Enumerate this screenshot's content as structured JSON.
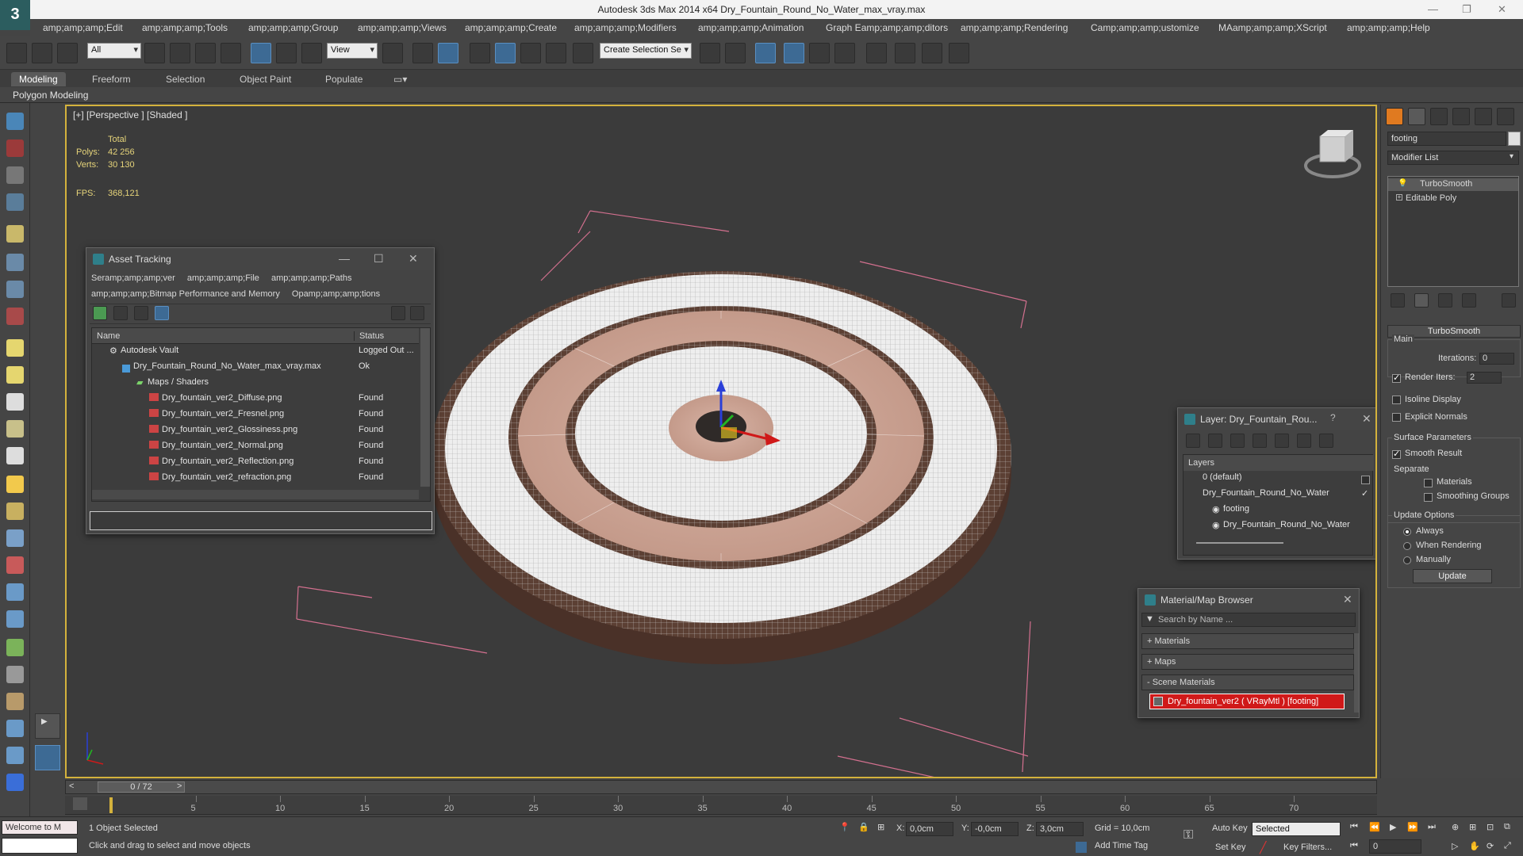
{
  "window": {
    "title": "Autodesk 3ds Max  2014 x64     Dry_Fountain_Round_No_Water_max_vray.max",
    "logo": "3"
  },
  "menu": [
    "amp;amp;amp;Edit",
    "amp;amp;amp;Tools",
    "amp;amp;amp;Group",
    "amp;amp;amp;Views",
    "amp;amp;amp;Create",
    "amp;amp;amp;Modifiers",
    "amp;amp;amp;Animation",
    "Graph Eamp;amp;amp;ditors",
    "amp;amp;amp;Rendering",
    "Camp;amp;amp;ustomize",
    "MAamp;amp;amp;XScript",
    "amp;amp;amp;Help"
  ],
  "toolbar": {
    "filter_value": "All",
    "refcoord_value": "View",
    "selection_set_placeholder": "Create Selection Se"
  },
  "ribbon": {
    "tabs": [
      "Modeling",
      "Freeform",
      "Selection",
      "Object Paint",
      "Populate"
    ],
    "active": "Modeling",
    "subpanel": "Polygon Modeling"
  },
  "viewport": {
    "label": "[+] [Perspective ] [Shaded ]",
    "stats": {
      "total_label": "Total",
      "polys_label": "Polys:",
      "polys_value": "42 256",
      "verts_label": "Verts:",
      "verts_value": "30 130",
      "fps_label": "FPS:",
      "fps_value": "368,121"
    }
  },
  "asset_tracking": {
    "title": "Asset Tracking",
    "menu": [
      "Seramp;amp;amp;ver",
      "amp;amp;amp;File",
      "amp;amp;amp;Paths",
      "amp;amp;amp;Bitmap Performance and Memory",
      "Opamp;amp;amp;tions"
    ],
    "columns": [
      "Name",
      "Status"
    ],
    "rows": [
      {
        "name": "Autodesk Vault",
        "status": "Logged Out ..."
      },
      {
        "name": "Dry_Fountain_Round_No_Water_max_vray.max",
        "status": "Ok"
      },
      {
        "name": "Maps / Shaders",
        "status": ""
      },
      {
        "name": "Dry_fountain_ver2_Diffuse.png",
        "status": "Found"
      },
      {
        "name": "Dry_fountain_ver2_Fresnel.png",
        "status": "Found"
      },
      {
        "name": "Dry_fountain_ver2_Glossiness.png",
        "status": "Found"
      },
      {
        "name": "Dry_fountain_ver2_Normal.png",
        "status": "Found"
      },
      {
        "name": "Dry_fountain_ver2_Reflection.png",
        "status": "Found"
      },
      {
        "name": "Dry_fountain_ver2_refraction.png",
        "status": "Found"
      }
    ]
  },
  "layer_window": {
    "title": "Layer: Dry_Fountain_Rou...",
    "help": "?",
    "header": "Layers",
    "items": [
      "0 (default)",
      "Dry_Fountain_Round_No_Water",
      "footing",
      "Dry_Fountain_Round_No_Water"
    ]
  },
  "material_browser": {
    "title": "Material/Map Browser",
    "search_placeholder": "Search by Name ...",
    "groups": [
      "+ Materials",
      "+ Maps",
      "- Scene Materials"
    ],
    "scene_material": "Dry_fountain_ver2 ( VRayMtl ) [footing]"
  },
  "command_panel": {
    "object_name": "footing",
    "modifier_list": "Modifier List",
    "stack": [
      "TurboSmooth",
      "Editable Poly"
    ],
    "rollout_title": "TurboSmooth",
    "main_label": "Main",
    "iterations_label": "Iterations:",
    "iterations_value": "0",
    "render_iters_label": "Render Iters:",
    "render_iters_value": "2",
    "isoline_label": "Isoline Display",
    "explicit_normals_label": "Explicit Normals",
    "surface_params_label": "Surface Parameters",
    "smooth_result_label": "Smooth Result",
    "separate_label": "Separate",
    "materials_label": "Materials",
    "smoothing_groups_label": "Smoothing Groups",
    "update_options_label": "Update Options",
    "always_label": "Always",
    "when_rendering_label": "When Rendering",
    "manually_label": "Manually",
    "update_button": "Update"
  },
  "timeline": {
    "frame": "0 / 72",
    "ticks": [
      "5",
      "10",
      "15",
      "20",
      "25",
      "30",
      "35",
      "40",
      "45",
      "50",
      "55",
      "60",
      "65",
      "70"
    ]
  },
  "status": {
    "maxscript": "Welcome to M",
    "selected": "1 Object Selected",
    "prompt": "Click and drag to select and move objects",
    "x_label": "X:",
    "x_value": "0,0cm",
    "y_label": "Y:",
    "y_value": "-0,0cm",
    "z_label": "Z:",
    "z_value": "3,0cm",
    "grid": "Grid = 10,0cm",
    "add_time_tag": "Add Time Tag",
    "auto_key": "Auto Key",
    "set_key": "Set Key",
    "key_mode": "Selected",
    "key_filters": "Key Filters...",
    "frame_value": "0"
  },
  "colors": {
    "accent": "#d4b23c",
    "selection_red": "#d01919",
    "stat_yellow": "#e6d47a"
  }
}
